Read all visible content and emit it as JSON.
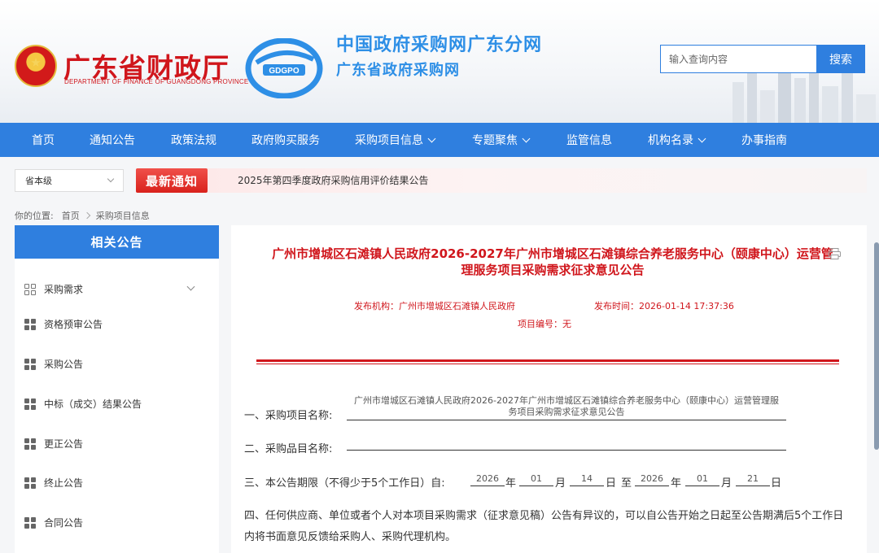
{
  "header": {
    "dept_name": "广东省财政厅",
    "dept_en": "DEPARTMENT OF FINANCE OF GUANGDONG PROVINCE",
    "logo_text": "GDGPO",
    "site_title": "中国政府采购网广东分网",
    "site_subtitle": "广东省政府采购网",
    "search_placeholder": "输入查询内容",
    "search_button": "搜索"
  },
  "nav": {
    "items": [
      {
        "label": "首页"
      },
      {
        "label": "通知公告"
      },
      {
        "label": "政策法规"
      },
      {
        "label": "政府购买服务"
      },
      {
        "label": "采购项目信息"
      },
      {
        "label": "专题聚焦"
      },
      {
        "label": "监管信息"
      },
      {
        "label": "机构名录"
      },
      {
        "label": "办事指南"
      }
    ]
  },
  "notice": {
    "region": "省本级",
    "badge": "最新通知",
    "text": "2025年第四季度政府采购信用评价结果公告"
  },
  "breadcrumb": {
    "prefix": "你的位置:",
    "home": "首页",
    "current": "采购项目信息"
  },
  "sidebar": {
    "title": "相关公告",
    "items": [
      {
        "label": "采购需求"
      },
      {
        "label": "资格预审公告"
      },
      {
        "label": "采购公告"
      },
      {
        "label": "中标（成交）结果公告"
      },
      {
        "label": "更正公告"
      },
      {
        "label": "终止公告"
      },
      {
        "label": "合同公告"
      }
    ]
  },
  "article": {
    "title": "广州市增城区石滩镇人民政府2026-2027年广州市增城区石滩镇综合养老服务中心（颐康中心）运营管理服务项目采购需求征求意见公告",
    "publisher_label": "发布机构：",
    "publisher": "广州市增城区石滩镇人民政府",
    "time_label": "发布时间：",
    "time": "2026-01-14 17:37:36",
    "project_no_label": "项目编号：",
    "project_no": "无",
    "item1_label": "一、采购项目名称:",
    "item1_value": "广州市增城区石滩镇人民政府2026-2027年广州市增城区石滩镇综合养老服务中心（颐康中心）运营管理服务项目采购需求征求意见公告",
    "item2_label": "二、采购品目名称:",
    "item2_value": "",
    "item3_label": "三、本公告期限（不得少于5个工作日）自:",
    "start_year": "2026",
    "start_month": "01",
    "start_day": "14",
    "end_year": "2026",
    "end_month": "01",
    "end_day": "21",
    "unit_year": "年",
    "unit_month": "月",
    "unit_day": "日",
    "to": "至",
    "item4": "四、任何供应商、单位或者个人对本项目采购需求（征求意见稿）公告有异议的，可以自公告开始之日起至公告期满后5个工作日内将书面意见反馈给采购人、采购代理机构。"
  },
  "colors": {
    "brand_blue": "#2f7fdf",
    "title_red": "#d0161c",
    "site_title_blue": "#2e8fe6"
  }
}
